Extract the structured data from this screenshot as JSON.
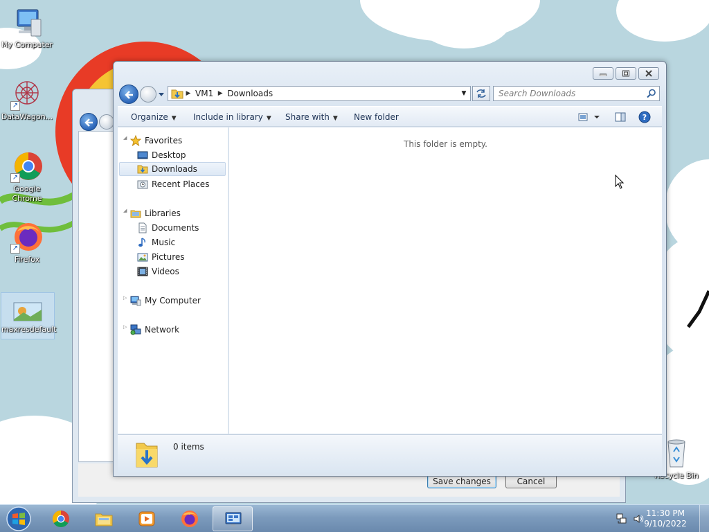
{
  "desktop": {
    "icons": [
      {
        "label": "My Computer",
        "icon": "computer-icon"
      },
      {
        "label": "DataWagon...",
        "icon": "datawagon-icon",
        "shortcut": true
      },
      {
        "label": "Google\nChrome",
        "icon": "chrome-icon",
        "shortcut": true
      },
      {
        "label": "Firefox",
        "icon": "firefox-icon",
        "shortcut": true
      },
      {
        "label": "maxresdefault",
        "icon": "image-file-icon",
        "selected": true
      },
      {
        "label": "Recycle Bin",
        "icon": "recycle-bin-icon"
      }
    ]
  },
  "background_dialog": {
    "save_label": "Save changes",
    "cancel_label": "Cancel"
  },
  "explorer": {
    "breadcrumb": [
      "VM1",
      "Downloads"
    ],
    "search_placeholder": "Search Downloads",
    "toolbar": {
      "organize": "Organize",
      "include_in_library": "Include in library",
      "share_with": "Share with",
      "new_folder": "New folder"
    },
    "nav": {
      "favorites": "Favorites",
      "desktop": "Desktop",
      "downloads": "Downloads",
      "recent_places": "Recent Places",
      "libraries": "Libraries",
      "documents": "Documents",
      "music": "Music",
      "pictures": "Pictures",
      "videos": "Videos",
      "my_computer": "My Computer",
      "network": "Network"
    },
    "selected_nav": "Downloads",
    "empty_message": "This folder is empty.",
    "item_count": "0 items"
  },
  "taskbar": {
    "apps": [
      "chrome-icon",
      "explorer-icon",
      "media-player-icon",
      "firefox-icon",
      "remote-desktop-icon"
    ],
    "active_app": "remote-desktop-icon",
    "time": "11:30 PM",
    "date": "9/10/2022"
  },
  "colors": {
    "desktop_bg": "#b9d6df",
    "accent_blue": "#2a64b8",
    "taskbar": "#7c9bbd"
  }
}
